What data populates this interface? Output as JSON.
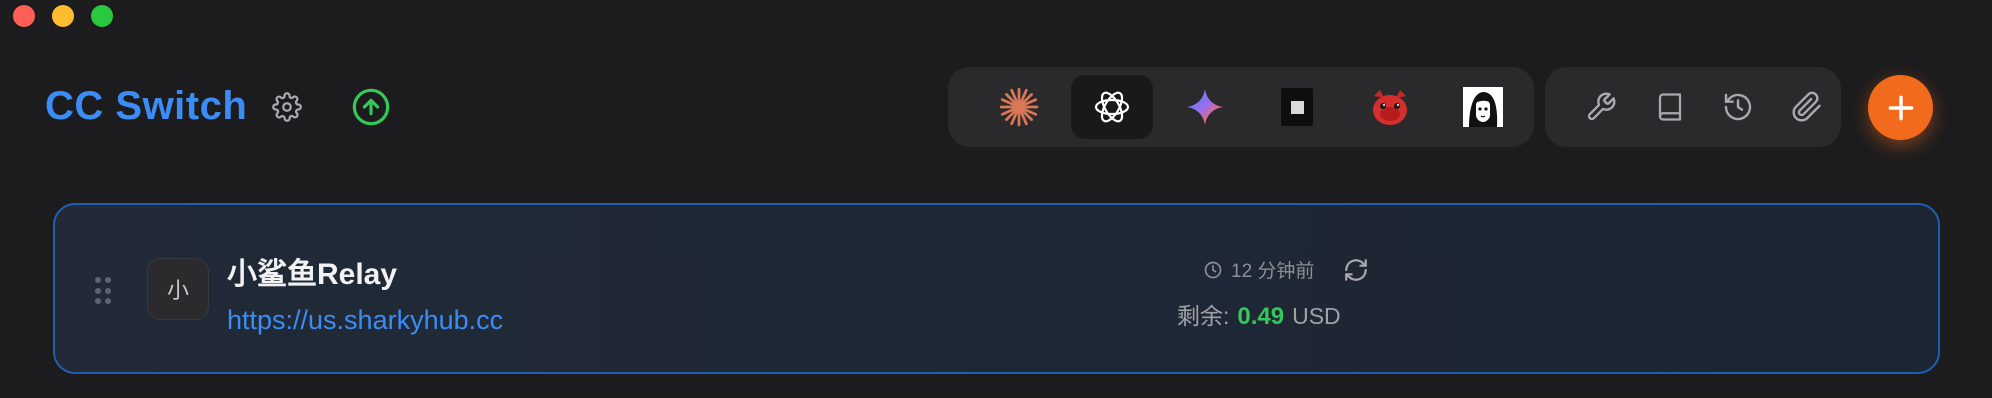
{
  "window": {
    "traffic_lights": [
      "close",
      "minimize",
      "maximize"
    ]
  },
  "header": {
    "title": "CC Switch",
    "settings_icon": "gear-icon",
    "upgrade_icon": "arrow-up-circle-icon"
  },
  "app_switcher": [
    {
      "name": "Claude",
      "icon": "claude-icon",
      "active": false
    },
    {
      "name": "Codex",
      "icon": "openai-icon",
      "active": true
    },
    {
      "name": "Gemini",
      "icon": "gemini-icon",
      "active": false
    },
    {
      "name": "Terminal",
      "icon": "terminal-icon",
      "active": false
    },
    {
      "name": "Mascot",
      "icon": "red-mascot-icon",
      "active": false
    },
    {
      "name": "Avatar",
      "icon": "avatar-portrait-icon",
      "active": false
    }
  ],
  "tools": [
    {
      "icon": "wrench-icon"
    },
    {
      "icon": "book-icon"
    },
    {
      "icon": "history-icon"
    },
    {
      "icon": "paperclip-icon"
    }
  ],
  "add_button": {
    "icon": "plus-icon"
  },
  "provider": {
    "avatar_text": "小",
    "name": "小鲨鱼Relay",
    "url": "https://us.sharkyhub.cc",
    "updated": "12 分钟前",
    "balance_label": "剩余:",
    "balance_value": "0.49",
    "currency": "USD"
  },
  "colors": {
    "background": "#1c1c1e",
    "accent_blue": "#3b8cf5",
    "add_orange": "#f26a1b",
    "balance_green": "#34c759",
    "card_border": "#1f5fb0"
  }
}
